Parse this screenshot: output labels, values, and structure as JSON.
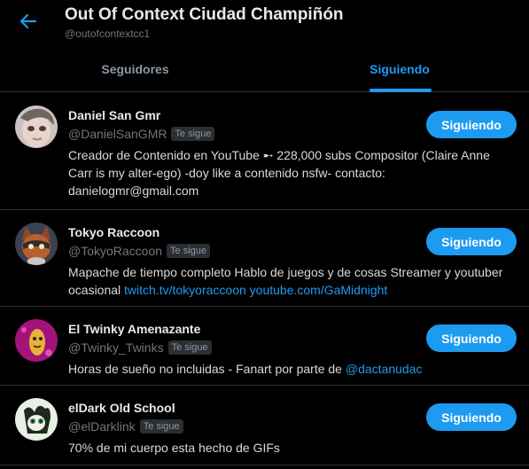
{
  "header": {
    "title": "Out Of Context Ciudad Champiñón",
    "handle": "@outofcontextcc1"
  },
  "tabs": [
    {
      "label": "Seguidores",
      "active": false
    },
    {
      "label": "Siguiendo",
      "active": true
    }
  ],
  "badge_label": "Te sigue",
  "follow_label": "Siguiendo",
  "users": [
    {
      "name": "Daniel San Gmr",
      "handle": "@DanielSanGMR",
      "bio_text": "Creador de Contenido en YouTube ➸ 228,000 subs Compositor (Claire Anne Carr is my alter-ego) -doy like a contenido nsfw- contacto: danielogmr@gmail.com",
      "links": []
    },
    {
      "name": "Tokyo Raccoon",
      "handle": "@TokyoRaccoon",
      "bio_text": "Mapache de tiempo completo Hablo de juegos y de cosas Streamer y youtuber ocasional ",
      "links": [
        "twitch.tv/tokyoraccoon",
        "youtube.com/GaMidnight"
      ]
    },
    {
      "name": "El Twinky Amenazante",
      "handle": "@Twinky_Twinks",
      "bio_text": "Horas de sueño no incluidas - Fanart por parte de ",
      "links": [
        "@dactanudac"
      ]
    },
    {
      "name": "elDark Old School",
      "handle": "@elDarklink",
      "bio_text": "70% de mi cuerpo esta hecho de GIFs",
      "links": []
    }
  ],
  "colors": {
    "accent": "#1d9bf0",
    "background": "#000000",
    "muted": "#71767b"
  }
}
